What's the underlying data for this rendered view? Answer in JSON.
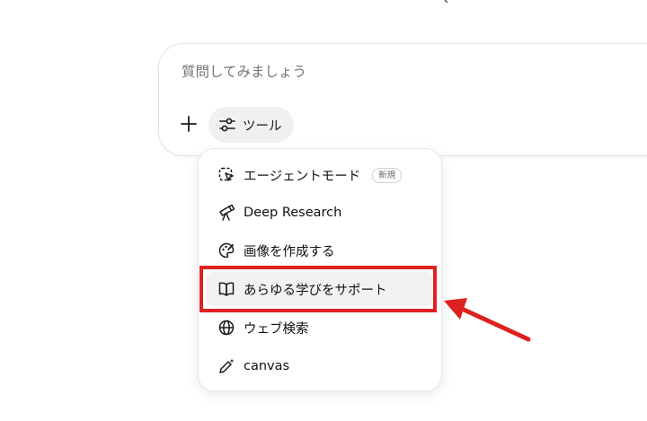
{
  "composer": {
    "placeholder": "質問してみましょう",
    "tools_label": "ツール"
  },
  "menu": {
    "items": [
      {
        "label": "エージェントモード",
        "icon": "agent-cursor-icon",
        "badge": "新規"
      },
      {
        "label": "Deep Research",
        "icon": "telescope-icon"
      },
      {
        "label": "画像を作成する",
        "icon": "palette-icon"
      },
      {
        "label": "あらゆる学びをサポート",
        "icon": "book-open-icon",
        "selected": true
      },
      {
        "label": "ウェブ検索",
        "icon": "globe-icon"
      },
      {
        "label": "canvas",
        "icon": "pen-sparkle-icon"
      }
    ]
  },
  "annotation": {
    "highlight_color": "#e02020",
    "target": "あらゆる学びをサポート"
  }
}
